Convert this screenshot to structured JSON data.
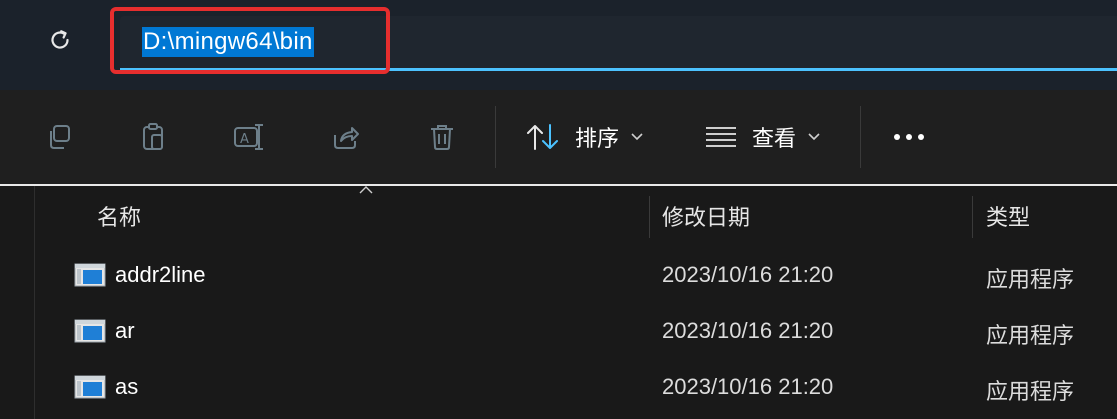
{
  "address_bar": {
    "path": "D:\\mingw64\\bin"
  },
  "toolbar": {
    "sort_label": "排序",
    "view_label": "查看"
  },
  "columns": {
    "name": "名称",
    "date": "修改日期",
    "type": "类型"
  },
  "files": [
    {
      "name": "addr2line",
      "date": "2023/10/16 21:20",
      "type": "应用程序"
    },
    {
      "name": "ar",
      "date": "2023/10/16 21:20",
      "type": "应用程序"
    },
    {
      "name": "as",
      "date": "2023/10/16 21:20",
      "type": "应用程序"
    }
  ],
  "colors": {
    "accent": "#4cc2ff",
    "selection": "#0078d4",
    "highlight_frame": "#e62e2e"
  }
}
